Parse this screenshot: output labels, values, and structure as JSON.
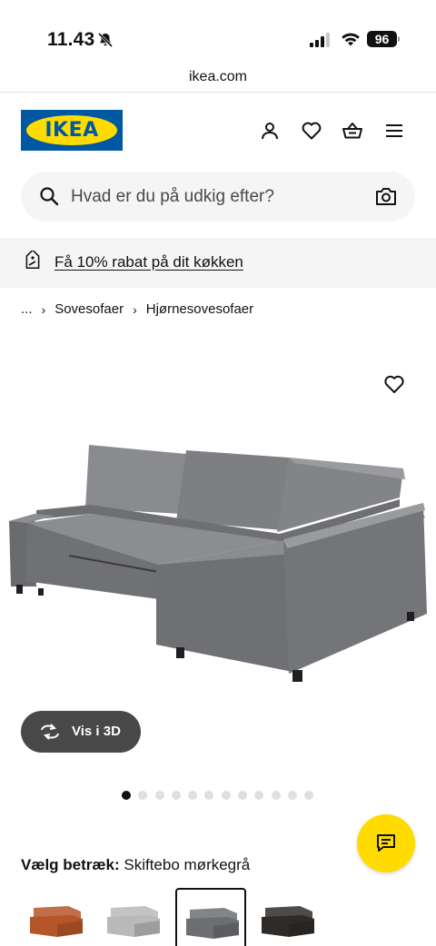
{
  "status_bar": {
    "time": "11.43",
    "battery": "96"
  },
  "browser": {
    "url": "ikea.com"
  },
  "header": {
    "logo_text": "IKEA",
    "icons": [
      "account-icon",
      "heart-icon",
      "basket-icon",
      "menu-icon"
    ]
  },
  "search": {
    "placeholder": "Hvad er du på udkig efter?"
  },
  "promo": {
    "text": "Få 10% rabat på dit køkken"
  },
  "breadcrumb": {
    "ellipsis": "...",
    "items": [
      "Sovesofaer",
      "Hjørnesovesofaer"
    ]
  },
  "product": {
    "view_3d_label": "Vis i 3D",
    "image_count": 12,
    "active_image_index": 0,
    "variant_label": "Vælg betræk:",
    "variant_value": "Skiftebo mørkegrå",
    "swatches": [
      {
        "color": "#b5562a",
        "selected": false
      },
      {
        "color": "#b9b9b9",
        "selected": false
      },
      {
        "color": "#6d6e71",
        "selected": true
      },
      {
        "color": "#2f2b28",
        "selected": false
      }
    ]
  },
  "colors": {
    "ikea_blue": "#0058a3",
    "ikea_yellow": "#ffdb00",
    "sofa_grey": "#77787b"
  }
}
